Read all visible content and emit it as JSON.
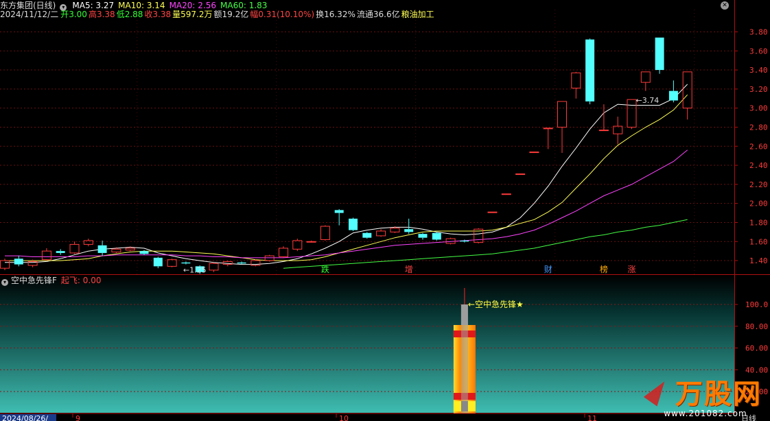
{
  "header": {
    "stock_name": "东方集团(日线)",
    "ma5": "MA5: 3.27",
    "ma10": "MA10: 3.14",
    "ma20": "MA20: 2.56",
    "ma60": "MA60: 1.83",
    "date": "2024/11/12/二",
    "open": "开3.00",
    "high": "高3.38",
    "low": "低2.88",
    "close": "收3.38",
    "volume": "量597.2万",
    "amount": "额19.2亿",
    "change": "幅0.31(10.10%)",
    "turnover": "换16.32%",
    "float_cap": "流通36.6亿",
    "industry": "粮油加工",
    "colors": {
      "ma5": "#ffffff",
      "ma10": "#ffff55",
      "ma20": "#ff44ff",
      "ma60": "#44ff44"
    }
  },
  "indicator": {
    "name": "空中急先锋F",
    "value_label": "起飞: 0.00",
    "signal_label": "←空中急先锋★",
    "ylim": [
      0,
      120
    ],
    "ticks": [
      "100.0",
      "80.00",
      "60.00",
      "40.00",
      "20.00"
    ]
  },
  "x_axis": {
    "start_date": "2024/08/26/",
    "month_ticks": [
      "9",
      "10",
      "11"
    ],
    "period": "日线"
  },
  "watermark": {
    "name": "万股网",
    "url": "www.201082.com"
  },
  "chart_data": {
    "type": "candlestick",
    "ylim": [
      1.25,
      3.9
    ],
    "y_ticks": [
      3.8,
      3.6,
      3.4,
      3.2,
      3.0,
      2.8,
      2.6,
      2.4,
      2.2,
      2.0,
      1.8,
      1.6,
      1.4
    ],
    "grid": true,
    "annotations": [
      {
        "text": "←1.25",
        "kind": "low_marker",
        "candle_index": 13
      },
      {
        "text": "←3.74",
        "kind": "high_marker",
        "candle_index": 45
      }
    ],
    "candles": [
      {
        "o": 1.32,
        "h": 1.42,
        "l": 1.3,
        "c": 1.4
      },
      {
        "o": 1.42,
        "h": 1.45,
        "l": 1.34,
        "c": 1.36
      },
      {
        "o": 1.35,
        "h": 1.41,
        "l": 1.33,
        "c": 1.39
      },
      {
        "o": 1.41,
        "h": 1.53,
        "l": 1.4,
        "c": 1.5
      },
      {
        "o": 1.5,
        "h": 1.52,
        "l": 1.46,
        "c": 1.48
      },
      {
        "o": 1.48,
        "h": 1.6,
        "l": 1.47,
        "c": 1.57
      },
      {
        "o": 1.57,
        "h": 1.63,
        "l": 1.55,
        "c": 1.61
      },
      {
        "o": 1.56,
        "h": 1.61,
        "l": 1.45,
        "c": 1.48
      },
      {
        "o": 1.49,
        "h": 1.54,
        "l": 1.48,
        "c": 1.52
      },
      {
        "o": 1.51,
        "h": 1.55,
        "l": 1.5,
        "c": 1.53
      },
      {
        "o": 1.5,
        "h": 1.51,
        "l": 1.46,
        "c": 1.47
      },
      {
        "o": 1.43,
        "h": 1.44,
        "l": 1.32,
        "c": 1.34
      },
      {
        "o": 1.34,
        "h": 1.42,
        "l": 1.33,
        "c": 1.41
      },
      {
        "o": 1.38,
        "h": 1.39,
        "l": 1.36,
        "c": 1.37
      },
      {
        "o": 1.34,
        "h": 1.35,
        "l": 1.26,
        "c": 1.28
      },
      {
        "o": 1.3,
        "h": 1.38,
        "l": 1.28,
        "c": 1.37
      },
      {
        "o": 1.36,
        "h": 1.4,
        "l": 1.34,
        "c": 1.39
      },
      {
        "o": 1.38,
        "h": 1.39,
        "l": 1.36,
        "c": 1.37
      },
      {
        "o": 1.35,
        "h": 1.41,
        "l": 1.34,
        "c": 1.4
      },
      {
        "o": 1.4,
        "h": 1.46,
        "l": 1.39,
        "c": 1.45
      },
      {
        "o": 1.44,
        "h": 1.55,
        "l": 1.43,
        "c": 1.53
      },
      {
        "o": 1.52,
        "h": 1.63,
        "l": 1.5,
        "c": 1.61
      },
      {
        "o": 1.6,
        "h": 1.61,
        "l": 1.59,
        "c": 1.6
      },
      {
        "o": 1.62,
        "h": 1.77,
        "l": 1.61,
        "c": 1.76
      },
      {
        "o": 1.93,
        "h": 1.94,
        "l": 1.77,
        "c": 1.9
      },
      {
        "o": 1.84,
        "h": 1.85,
        "l": 1.71,
        "c": 1.72
      },
      {
        "o": 1.69,
        "h": 1.7,
        "l": 1.63,
        "c": 1.64
      },
      {
        "o": 1.66,
        "h": 1.73,
        "l": 1.65,
        "c": 1.71
      },
      {
        "o": 1.7,
        "h": 1.76,
        "l": 1.69,
        "c": 1.74
      },
      {
        "o": 1.73,
        "h": 1.84,
        "l": 1.68,
        "c": 1.7
      },
      {
        "o": 1.68,
        "h": 1.69,
        "l": 1.62,
        "c": 1.64
      },
      {
        "o": 1.69,
        "h": 1.7,
        "l": 1.61,
        "c": 1.62
      },
      {
        "o": 1.58,
        "h": 1.64,
        "l": 1.57,
        "c": 1.63
      },
      {
        "o": 1.61,
        "h": 1.62,
        "l": 1.59,
        "c": 1.6
      },
      {
        "o": 1.59,
        "h": 1.74,
        "l": 1.58,
        "c": 1.73
      },
      {
        "o": 1.91,
        "h": 1.91,
        "l": 1.91,
        "c": 1.91
      },
      {
        "o": 2.1,
        "h": 2.1,
        "l": 2.1,
        "c": 2.1
      },
      {
        "o": 2.31,
        "h": 2.31,
        "l": 2.31,
        "c": 2.31
      },
      {
        "o": 2.54,
        "h": 2.54,
        "l": 2.54,
        "c": 2.54
      },
      {
        "o": 2.79,
        "h": 2.79,
        "l": 2.57,
        "c": 2.79
      },
      {
        "o": 2.8,
        "h": 3.07,
        "l": 2.53,
        "c": 3.07
      },
      {
        "o": 3.21,
        "h": 3.38,
        "l": 3.1,
        "c": 3.37
      },
      {
        "o": 3.72,
        "h": 3.73,
        "l": 3.04,
        "c": 3.07
      },
      {
        "o": 2.77,
        "h": 3.04,
        "l": 2.76,
        "c": 2.77
      },
      {
        "o": 2.73,
        "h": 2.91,
        "l": 2.62,
        "c": 2.81
      },
      {
        "o": 2.8,
        "h": 3.09,
        "l": 2.78,
        "c": 3.09
      },
      {
        "o": 3.27,
        "h": 3.38,
        "l": 3.18,
        "c": 3.38
      },
      {
        "o": 3.74,
        "h": 3.74,
        "l": 3.36,
        "c": 3.4
      },
      {
        "o": 3.18,
        "h": 3.29,
        "l": 3.06,
        "c": 3.08
      },
      {
        "o": 3.0,
        "h": 3.38,
        "l": 2.88,
        "c": 3.38
      }
    ],
    "series": [
      {
        "name": "MA5",
        "values": [
          1.38,
          1.38,
          1.38,
          1.39,
          1.42,
          1.46,
          1.5,
          1.52,
          1.53,
          1.54,
          1.53,
          1.48,
          1.45,
          1.42,
          1.4,
          1.38,
          1.37,
          1.36,
          1.36,
          1.37,
          1.39,
          1.42,
          1.47,
          1.53,
          1.6,
          1.69,
          1.72,
          1.74,
          1.75,
          1.75,
          1.73,
          1.7,
          1.68,
          1.67,
          1.68,
          1.7,
          1.75,
          1.85,
          2.0,
          2.18,
          2.39,
          2.58,
          2.78,
          2.95,
          3.04,
          3.03,
          3.03,
          3.03,
          3.1,
          3.25
        ]
      },
      {
        "name": "MA10",
        "values": [
          1.4,
          1.4,
          1.4,
          1.4,
          1.4,
          1.41,
          1.42,
          1.45,
          1.47,
          1.49,
          1.5,
          1.5,
          1.5,
          1.49,
          1.48,
          1.47,
          1.45,
          1.43,
          1.41,
          1.4,
          1.4,
          1.4,
          1.41,
          1.44,
          1.48,
          1.52,
          1.56,
          1.6,
          1.64,
          1.67,
          1.7,
          1.71,
          1.71,
          1.71,
          1.71,
          1.72,
          1.75,
          1.79,
          1.83,
          1.91,
          2.01,
          2.16,
          2.31,
          2.47,
          2.61,
          2.71,
          2.8,
          2.88,
          2.98,
          3.14
        ]
      },
      {
        "name": "MA20",
        "values": [
          1.45,
          1.45,
          1.44,
          1.44,
          1.44,
          1.44,
          1.45,
          1.45,
          1.46,
          1.46,
          1.46,
          1.46,
          1.46,
          1.45,
          1.45,
          1.44,
          1.44,
          1.43,
          1.43,
          1.43,
          1.43,
          1.44,
          1.45,
          1.46,
          1.48,
          1.5,
          1.52,
          1.54,
          1.56,
          1.57,
          1.58,
          1.59,
          1.6,
          1.61,
          1.62,
          1.63,
          1.65,
          1.68,
          1.72,
          1.78,
          1.85,
          1.92,
          2.0,
          2.08,
          2.14,
          2.2,
          2.28,
          2.36,
          2.44,
          2.56
        ]
      },
      {
        "name": "MA60",
        "values": [
          null,
          null,
          null,
          null,
          null,
          null,
          null,
          null,
          null,
          null,
          null,
          null,
          null,
          null,
          null,
          null,
          null,
          null,
          null,
          null,
          1.32,
          1.33,
          1.34,
          1.35,
          1.36,
          1.37,
          1.38,
          1.39,
          1.4,
          1.41,
          1.42,
          1.43,
          1.44,
          1.45,
          1.46,
          1.47,
          1.49,
          1.51,
          1.53,
          1.56,
          1.59,
          1.62,
          1.65,
          1.67,
          1.7,
          1.72,
          1.75,
          1.77,
          1.8,
          1.83
        ]
      }
    ],
    "event_labels": [
      {
        "text": "跌",
        "candle_index": 23,
        "color": "#33ff33"
      },
      {
        "text": "增",
        "candle_index": 29,
        "color": "#ff4444"
      },
      {
        "text": "财",
        "candle_index": 39,
        "color": "#4499ff"
      },
      {
        "text": "榜",
        "candle_index": 43,
        "color": "#ffaa00"
      },
      {
        "text": "涨",
        "candle_index": 45,
        "color": "#ff4444"
      }
    ],
    "indicator_signal": {
      "candle_index": 33,
      "value": 100,
      "low": 0
    }
  }
}
